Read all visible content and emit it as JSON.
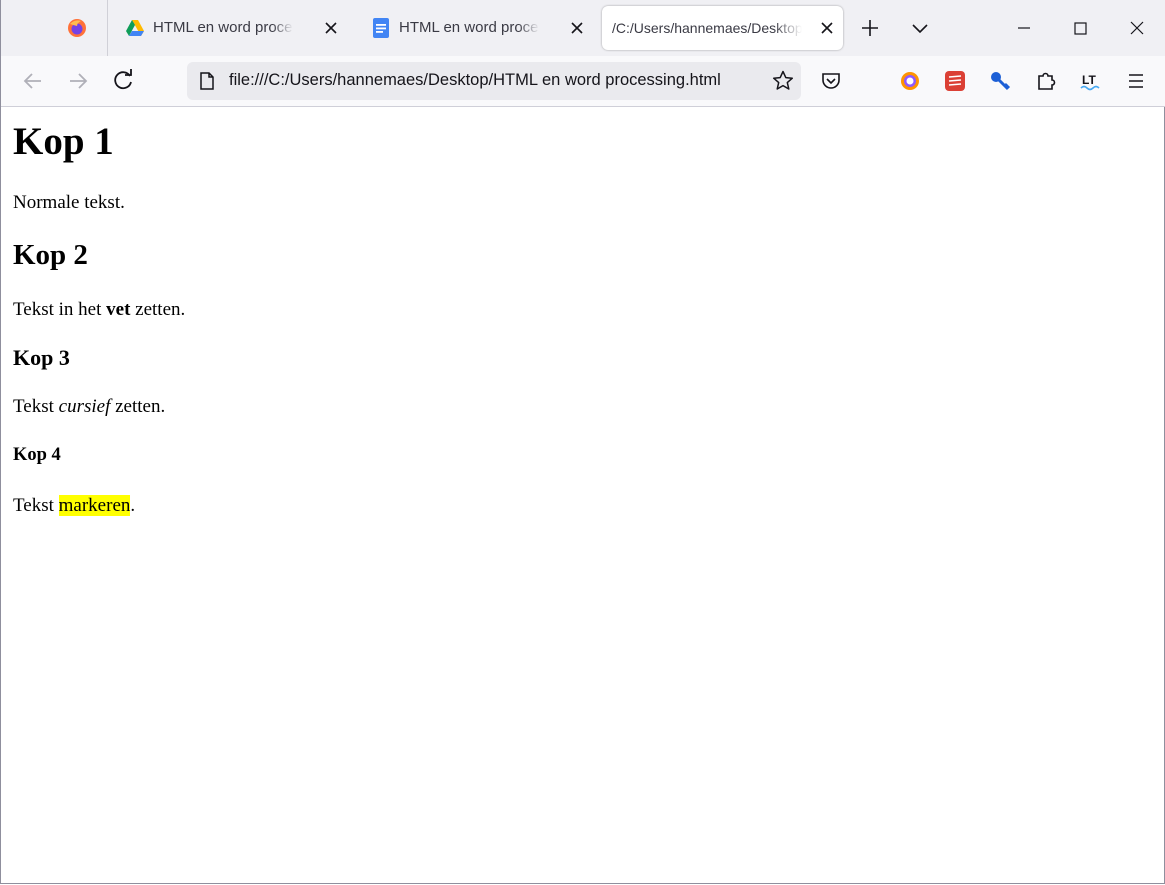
{
  "tabs": [
    {
      "title": "HTML en word processing",
      "icon": "google-drive-icon"
    },
    {
      "title": "HTML en word processing",
      "icon": "google-docs-icon"
    },
    {
      "title": "/C:/Users/hannemaes/Desktop/HTML en word processing.html",
      "active": true
    }
  ],
  "address_bar": {
    "url": "file:///C:/Users/hannemaes/Desktop/HTML en word processing.html"
  },
  "extensions": [
    "firefox-account-icon",
    "todoist-icon",
    "key-icon",
    "extensions-icon",
    "languagetool-icon"
  ],
  "page": {
    "h1": "Kop 1",
    "p1": "Normale tekst.",
    "h2": "Kop 2",
    "p2": {
      "before": "Tekst in het ",
      "bold": "vet",
      "after": " zetten."
    },
    "h3": "Kop 3",
    "p3": {
      "before": "Tekst ",
      "italic": "cursief",
      "after": " zetten."
    },
    "h4": "Kop 4",
    "p4": {
      "before": "Tekst ",
      "highlight": "markeren",
      "after": "."
    }
  },
  "colors": {
    "highlight": "#ffff00",
    "tabbar": "#f0f0f4",
    "toolbar": "#f9f9fb",
    "urlbar": "#eaeaee"
  }
}
